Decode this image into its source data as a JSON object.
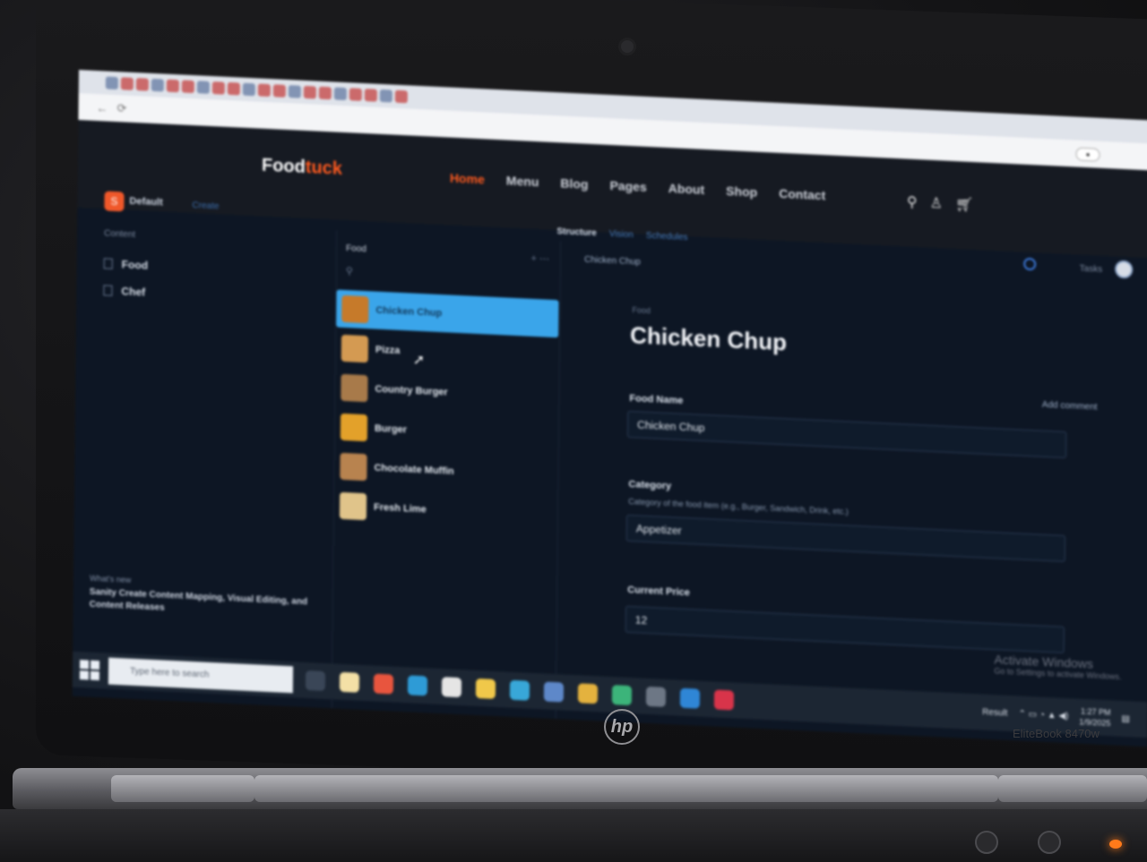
{
  "site": {
    "logo_main": "Food",
    "logo_accent": "tuck",
    "menu": [
      "Home",
      "Menu",
      "Blog",
      "Pages",
      "About",
      "Shop",
      "Contact"
    ],
    "accent_color": "#ff5a1f"
  },
  "studio": {
    "workspace": "Default",
    "create": "Create",
    "tools": [
      "Structure",
      "Vision",
      "Schedules"
    ],
    "tasks": "Tasks"
  },
  "content_pane": {
    "heading": "Content",
    "items": [
      "Food",
      "Chef"
    ]
  },
  "list_pane": {
    "heading": "Food",
    "items": [
      {
        "title": "Chicken Chup",
        "selected": true
      },
      {
        "title": "Pizza"
      },
      {
        "title": "Country Burger"
      },
      {
        "title": "Burger"
      },
      {
        "title": "Chocolate Muffin"
      },
      {
        "title": "Fresh Lime"
      }
    ]
  },
  "editor": {
    "breadcrumb": "Chicken Chup",
    "type": "Food",
    "title": "Chicken Chup",
    "add_comment": "Add comment",
    "fields": {
      "food_name_label": "Food Name",
      "food_name_value": "Chicken Chup",
      "category_label": "Category",
      "category_desc": "Category of the food item (e.g., Burger, Sandwich, Drink, etc.)",
      "category_value": "Appetizer",
      "price_label": "Current Price",
      "price_value": "12"
    }
  },
  "whats_new": {
    "label": "What's new",
    "text": "Sanity Create Content Mapping, Visual Editing, and Content Releases"
  },
  "windows": {
    "activate_title": "Activate Windows",
    "activate_sub": "Go to Settings to activate Windows.",
    "search_placeholder": "Type here to search",
    "weather": "Result",
    "time": "1:27 PM",
    "date": "1/9/2025"
  },
  "laptop": {
    "brand": "hp",
    "model": "EliteBook 8470w"
  }
}
